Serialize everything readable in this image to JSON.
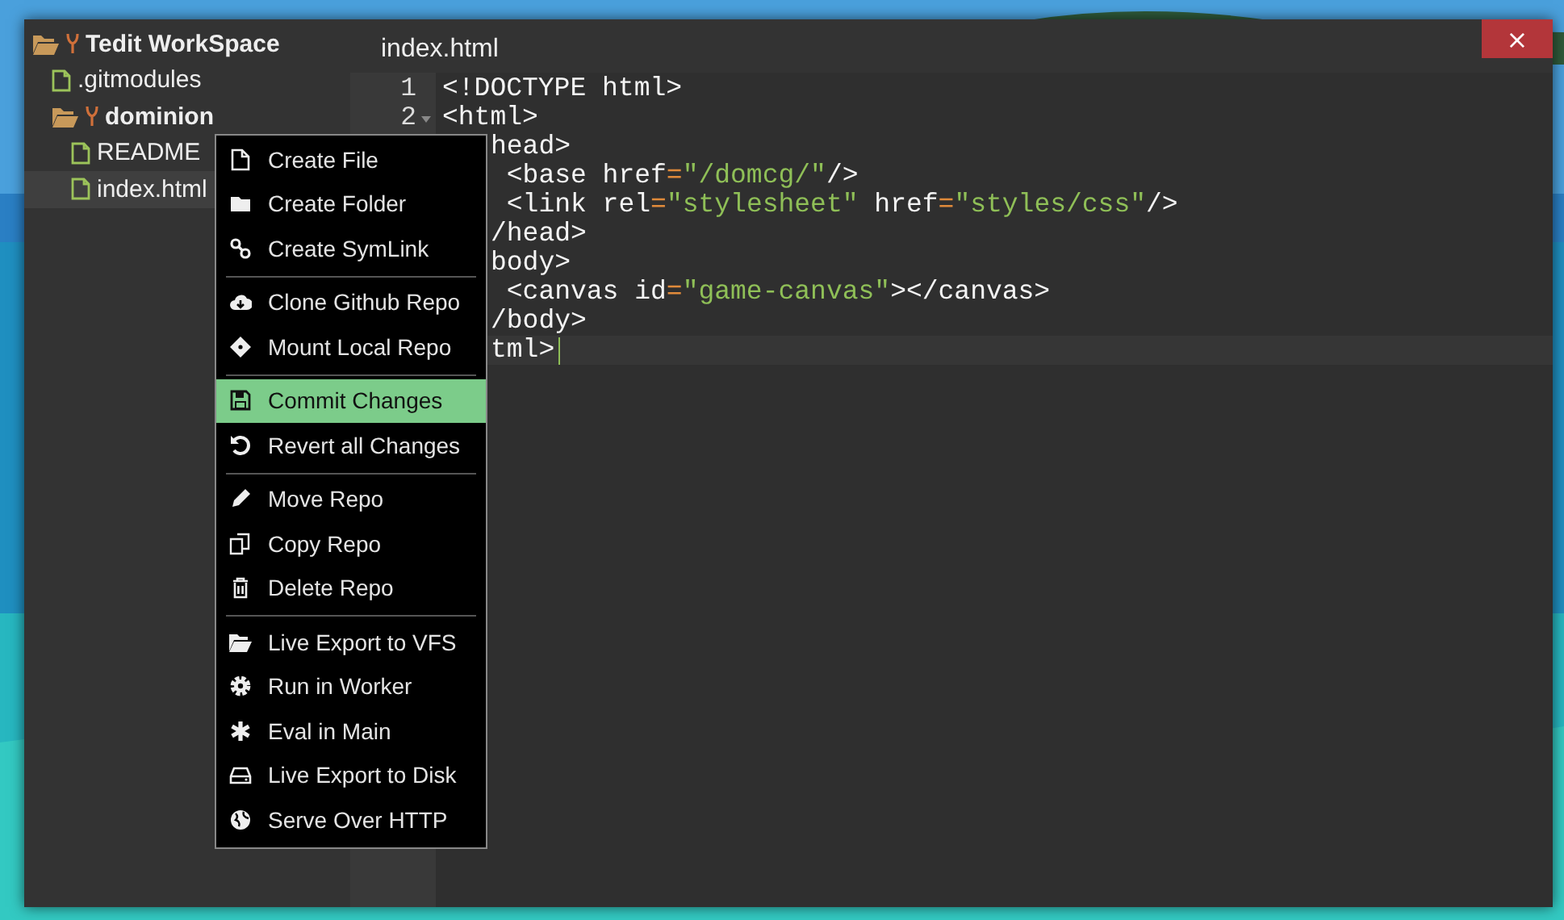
{
  "window": {
    "close": "×"
  },
  "sidebar": {
    "tree": [
      {
        "name": "Tedit WorkSpace",
        "kind": "repo",
        "expanded": true,
        "selected": false,
        "children": [
          {
            "name": ".gitmodules",
            "kind": "file",
            "selected": false
          },
          {
            "name": "dominion",
            "kind": "repo",
            "expanded": true,
            "selected": false,
            "children": [
              {
                "name": "README",
                "kind": "file",
                "selected": false
              },
              {
                "name": "index.html",
                "kind": "file",
                "selected": true
              }
            ]
          }
        ]
      }
    ]
  },
  "editor": {
    "title": "index.html",
    "lines": [
      {
        "number": "1",
        "covered": false,
        "current": false,
        "tokens": [
          {
            "kind": "tag",
            "text": "<!DOCTYPE html>"
          }
        ]
      },
      {
        "number": "2",
        "fold": true,
        "covered": false,
        "current": false,
        "tokens": [
          {
            "kind": "tag",
            "text": "<html>"
          }
        ]
      },
      {
        "covered": true,
        "current": false,
        "tokens": [
          {
            "kind": "tag",
            "text": "head>"
          }
        ]
      },
      {
        "covered": true,
        "current": false,
        "tokens": [
          {
            "kind": "tag",
            "text": " <base href"
          },
          {
            "kind": "op",
            "text": "="
          },
          {
            "kind": "string",
            "text": "\"/domcg/\""
          },
          {
            "kind": "tag",
            "text": "/>"
          }
        ]
      },
      {
        "covered": true,
        "current": false,
        "tokens": [
          {
            "kind": "tag",
            "text": " <link rel"
          },
          {
            "kind": "op",
            "text": "="
          },
          {
            "kind": "string",
            "text": "\"stylesheet\""
          },
          {
            "kind": "tag",
            "text": " href"
          },
          {
            "kind": "op",
            "text": "="
          },
          {
            "kind": "string",
            "text": "\"styles/css\""
          },
          {
            "kind": "tag",
            "text": "/>"
          }
        ]
      },
      {
        "covered": true,
        "current": false,
        "tokens": [
          {
            "kind": "tag",
            "text": "/head>"
          }
        ]
      },
      {
        "covered": true,
        "current": false,
        "tokens": [
          {
            "kind": "tag",
            "text": "body>"
          }
        ]
      },
      {
        "covered": true,
        "current": false,
        "tokens": [
          {
            "kind": "tag",
            "text": " <canvas id"
          },
          {
            "kind": "op",
            "text": "="
          },
          {
            "kind": "string",
            "text": "\"game-canvas\""
          },
          {
            "kind": "tag",
            "text": "></canvas>"
          }
        ]
      },
      {
        "covered": true,
        "current": false,
        "tokens": [
          {
            "kind": "tag",
            "text": "/body>"
          }
        ]
      },
      {
        "covered": true,
        "current": true,
        "tokens": [
          {
            "kind": "tag",
            "text": "tml>"
          }
        ]
      }
    ]
  },
  "context_menu": {
    "groups": [
      [
        {
          "label": "Create File",
          "selected": false
        },
        {
          "label": "Create Folder",
          "selected": false
        },
        {
          "label": "Create SymLink",
          "selected": false
        }
      ],
      [
        {
          "label": "Clone Github Repo",
          "selected": false
        },
        {
          "label": "Mount Local Repo",
          "selected": false
        }
      ],
      [
        {
          "label": "Commit Changes",
          "selected": true
        },
        {
          "label": "Revert all Changes",
          "selected": false
        }
      ],
      [
        {
          "label": "Move Repo",
          "selected": false
        },
        {
          "label": "Copy Repo",
          "selected": false
        },
        {
          "label": "Delete Repo",
          "selected": false
        }
      ],
      [
        {
          "label": "Live Export to VFS",
          "selected": false
        },
        {
          "label": "Run in Worker",
          "selected": false
        },
        {
          "label": "Eval in Main",
          "selected": false
        },
        {
          "label": "Live Export to Disk",
          "selected": false
        },
        {
          "label": "Serve Over HTTP",
          "selected": false
        }
      ]
    ]
  }
}
